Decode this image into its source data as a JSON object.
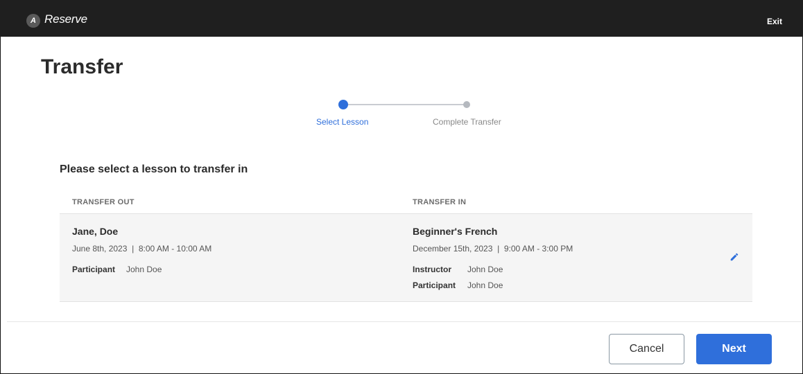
{
  "header": {
    "logo_glyph": "A",
    "brand": "Reserve",
    "exit_label": "Exit"
  },
  "page": {
    "title": "Transfer"
  },
  "stepper": {
    "steps": [
      {
        "label": "Select Lesson"
      },
      {
        "label": "Complete Transfer"
      }
    ]
  },
  "section": {
    "heading": "Please select a lesson to transfer in"
  },
  "table": {
    "columns": [
      "TRANSFER OUT",
      "TRANSFER IN"
    ],
    "row": {
      "out": {
        "name": "Jane, Doe",
        "datetime": "June 8th, 2023  |  8:00 AM - 10:00 AM",
        "participant_label": "Participant",
        "participant_value": "John Doe"
      },
      "in": {
        "name": "Beginner's French",
        "datetime": "December 15th, 2023  |  9:00 AM - 3:00 PM",
        "instructor_label": "Instructor",
        "instructor_value": "John Doe",
        "participant_label": "Participant",
        "participant_value": "John Doe"
      }
    }
  },
  "footer": {
    "cancel_label": "Cancel",
    "next_label": "Next"
  },
  "colors": {
    "accent": "#2f6fdb",
    "topbar": "#1f1f1f",
    "row_bg": "#f5f5f5"
  }
}
